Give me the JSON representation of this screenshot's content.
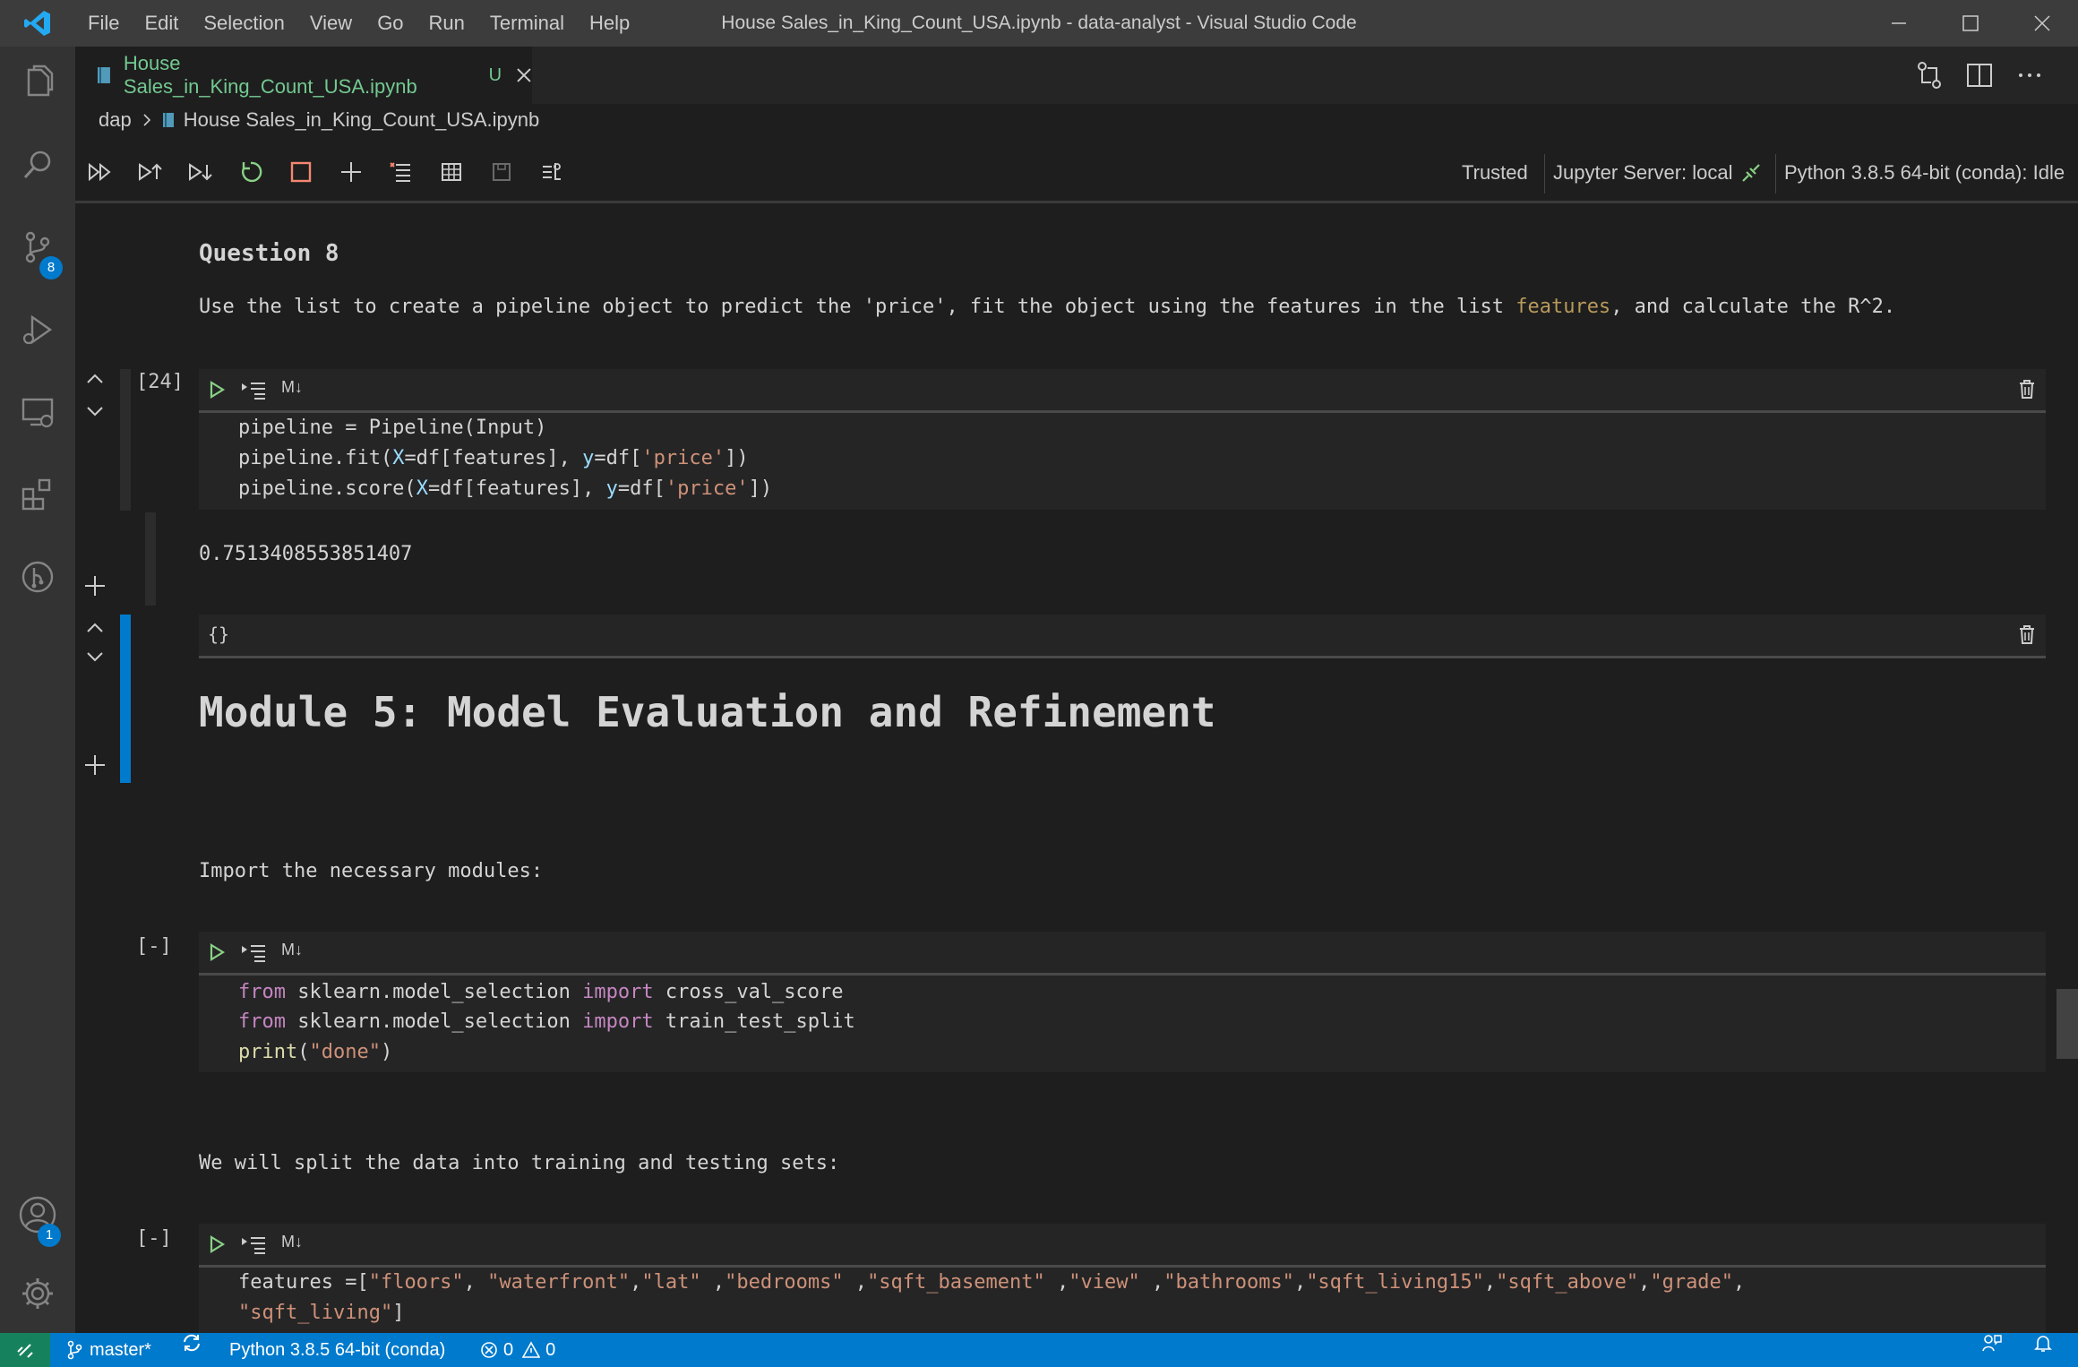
{
  "window": {
    "title": "House Sales_in_King_Count_USA.ipynb - data-analyst - Visual Studio Code",
    "menu": [
      "File",
      "Edit",
      "Selection",
      "View",
      "Go",
      "Run",
      "Terminal",
      "Help"
    ]
  },
  "activity_bar": {
    "items": [
      "explorer-icon",
      "search-icon",
      "source-control-icon",
      "run-debug-icon",
      "remote-explorer-icon",
      "extensions-icon",
      "git-graph-icon"
    ],
    "source_control_badge": "8",
    "accounts_badge": "1"
  },
  "tab": {
    "label": "House Sales_in_King_Count_USA.ipynb",
    "status": "U"
  },
  "breadcrumb": {
    "folder": "dap",
    "file": "House Sales_in_King_Count_USA.ipynb"
  },
  "toolbar": {
    "trusted": "Trusted",
    "server": "Jupyter Server: local",
    "kernel": "Python 3.8.5 64-bit (conda): Idle"
  },
  "notebook": {
    "question_heading": "Question 8",
    "question_text_before": "Use the list to create a pipeline object to predict the 'price', fit the object using the features in the list ",
    "question_text_highlight": "features",
    "question_text_after": ", and calculate the R^2.",
    "cell1": {
      "count": "[24]",
      "md_label": "M↓",
      "output": "0.7513408553851407"
    },
    "md_cell": {
      "toggle_label": "{}",
      "heading": "Module 5: Model Evaluation and Refinement"
    },
    "import_text": "Import the necessary modules:",
    "cell2": {
      "count": "[-]",
      "md_label": "M↓"
    },
    "split_text": "We will split the data into training and testing sets:",
    "cell3": {
      "count": "[-]",
      "md_label": "M↓"
    }
  },
  "status_bar": {
    "branch": "master*",
    "python": "Python 3.8.5 64-bit (conda)",
    "errors": "0",
    "warnings": "0"
  }
}
